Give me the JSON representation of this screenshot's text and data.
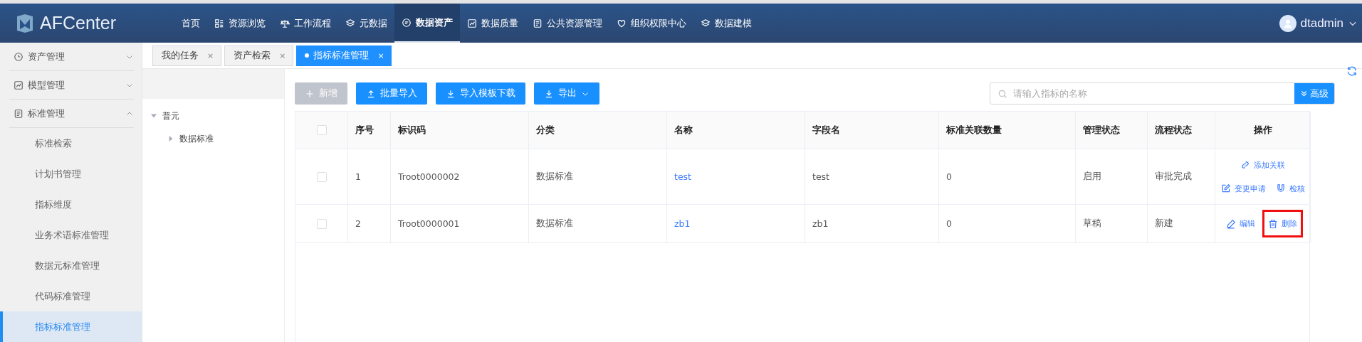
{
  "header": {
    "logo": "AFCenter",
    "nav": [
      {
        "label": "首页",
        "kind": "plain",
        "selected": false
      },
      {
        "label": "资源浏览",
        "kind": "grid",
        "selected": false
      },
      {
        "label": "工作流程",
        "kind": "scale",
        "selected": false
      },
      {
        "label": "元数据",
        "kind": "layers",
        "selected": false
      },
      {
        "label": "数据资产",
        "kind": "chat",
        "selected": true
      },
      {
        "label": "数据质量",
        "kind": "chart",
        "selected": false
      },
      {
        "label": "公共资源管理",
        "kind": "doc",
        "selected": false
      },
      {
        "label": "组织权限中心",
        "kind": "heart",
        "selected": false
      },
      {
        "label": "数据建模",
        "kind": "layers",
        "selected": false
      }
    ],
    "user": "dtadmin"
  },
  "sidebar": {
    "items": [
      {
        "label": "资产管理",
        "kind": "clock",
        "expanded": false
      },
      {
        "label": "模型管理",
        "kind": "chart",
        "expanded": false
      },
      {
        "label": "标准管理",
        "kind": "doc",
        "expanded": true,
        "children": [
          {
            "label": "标准检索",
            "selected": false
          },
          {
            "label": "计划书管理",
            "selected": false
          },
          {
            "label": "指标维度",
            "selected": false
          },
          {
            "label": "业务术语标准管理",
            "selected": false
          },
          {
            "label": "数据元标准管理",
            "selected": false
          },
          {
            "label": "代码标准管理",
            "selected": false
          },
          {
            "label": "指标标准管理",
            "selected": true
          }
        ]
      }
    ]
  },
  "tabs": [
    {
      "label": "我的任务",
      "close": "×",
      "selected": false
    },
    {
      "label": "资产检索",
      "close": "×",
      "selected": false
    },
    {
      "label": "指标标准管理",
      "close": "×",
      "selected": true
    }
  ],
  "tree": [
    {
      "label": "普元",
      "expanded": true,
      "children": [
        {
          "label": "数据标准",
          "expanded": false
        }
      ]
    }
  ],
  "toolbar": {
    "buttons": [
      {
        "label": "新增",
        "kind": "plus",
        "disabled": true
      },
      {
        "label": "批量导入",
        "kind": "upload",
        "disabled": false
      },
      {
        "label": "导入模板下载",
        "kind": "download",
        "disabled": false
      },
      {
        "label": "导出",
        "kind": "download",
        "disabled": false,
        "dropdown": true
      }
    ],
    "search": {
      "placeholder": "请输入指标的名称"
    },
    "advanced": "高级"
  },
  "table": {
    "all_checked": false,
    "columns": [
      "序号",
      "标识码",
      "分类",
      "名称",
      "字段名",
      "标准关联数量",
      "管理状态",
      "流程状态",
      "操作"
    ],
    "rows": [
      {
        "checked": false,
        "cells": [
          "1",
          "Troot0000002",
          "数据标准",
          "test",
          "test",
          "0",
          "启用",
          "审批完成"
        ],
        "actions": [
          [
            {
              "label": "添加关联",
              "kind": "link",
              "highlighted": false
            }
          ],
          [
            {
              "label": "变更申请",
              "kind": "edit",
              "highlighted": false
            },
            {
              "label": "检核",
              "kind": "magnet",
              "highlighted": false
            }
          ]
        ]
      },
      {
        "checked": false,
        "cells": [
          "2",
          "Troot0000001",
          "数据标准",
          "zb1",
          "zb1",
          "0",
          "草稿",
          "新建"
        ],
        "actions": [
          [
            {
              "label": "编辑",
              "kind": "pen",
              "highlighted": false
            },
            {
              "label": "删除",
              "kind": "trash",
              "highlighted": true
            }
          ]
        ]
      }
    ]
  }
}
